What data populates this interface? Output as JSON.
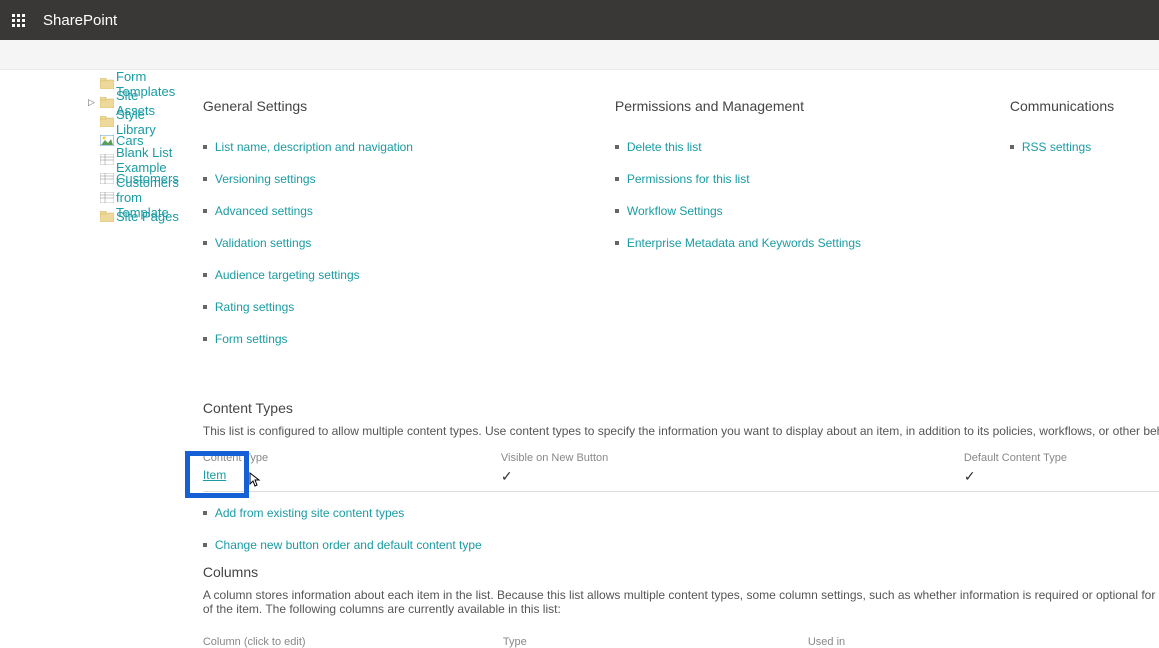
{
  "header": {
    "brand": "SharePoint"
  },
  "sidebar": {
    "items": [
      {
        "icon": "folder",
        "label": "Form Templates"
      },
      {
        "icon": "folder",
        "label": "Site Assets",
        "expandable": true
      },
      {
        "icon": "folder",
        "label": "Style Library"
      },
      {
        "icon": "picture",
        "label": "Cars"
      },
      {
        "icon": "list",
        "label": "Blank List Example"
      },
      {
        "icon": "list",
        "label": "Customers"
      },
      {
        "icon": "list",
        "label": "Customers from Template"
      },
      {
        "icon": "folder",
        "label": "Site Pages"
      }
    ]
  },
  "sections": {
    "general": {
      "title": "General Settings",
      "links": [
        "List name, description and navigation",
        "Versioning settings",
        "Advanced settings",
        "Validation settings",
        "Audience targeting settings",
        "Rating settings",
        "Form settings"
      ]
    },
    "permissions": {
      "title": "Permissions and Management",
      "links": [
        "Delete this list",
        "Permissions for this list",
        "Workflow Settings",
        "Enterprise Metadata and Keywords Settings"
      ]
    },
    "communications": {
      "title": "Communications",
      "links": [
        "RSS settings"
      ]
    }
  },
  "contentTypes": {
    "title": "Content Types",
    "description": "This list is configured to allow multiple content types. Use content types to specify the information you want to display about an item, in addition to its policies, workflows, or other behavior. The following",
    "headers": {
      "col1": "Content Type",
      "col2": "Visible on New Button",
      "col3": "Default Content Type"
    },
    "rows": [
      {
        "name": "Item",
        "visible": "✓",
        "default": "✓"
      }
    ],
    "actions": [
      "Add from existing site content types",
      "Change new button order and default content type"
    ]
  },
  "columns": {
    "title": "Columns",
    "description": "A column stores information about each item in the list. Because this list allows multiple content types, some column settings, such as whether information is required or optional for a column, are now specified by the content type of the item. The following columns are currently available in this list:",
    "headers": {
      "col1": "Column (click to edit)",
      "col2": "Type",
      "col3": "Used in"
    }
  }
}
